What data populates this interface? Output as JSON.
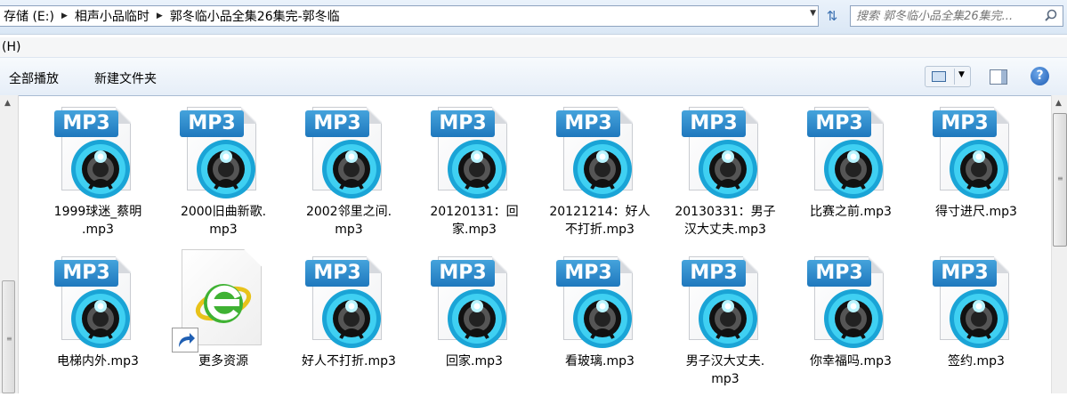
{
  "address": {
    "crumbs": [
      "存储 (E:)",
      "相声小品临时",
      "郭冬临小品全集26集完-郭冬临"
    ],
    "search_placeholder": "搜索 郭冬临小品全集26集完..."
  },
  "menu": {
    "items": [
      "(H)"
    ]
  },
  "toolbar": {
    "play_all": "全部播放",
    "new_folder": "新建文件夹"
  },
  "files": [
    {
      "name": "1999球迷_蔡明.mp3",
      "line1": "1999球迷_蔡明",
      "line2": ".mp3",
      "type": "mp3"
    },
    {
      "name": "2000旧曲新歌.mp3",
      "line1": "2000旧曲新歌.",
      "line2": "mp3",
      "type": "mp3"
    },
    {
      "name": "2002邻里之间.mp3",
      "line1": "2002邻里之间.",
      "line2": "mp3",
      "type": "mp3"
    },
    {
      "name": "20120131：回家.mp3",
      "line1": "20120131：回",
      "line2": "家.mp3",
      "type": "mp3"
    },
    {
      "name": "20121214：好人不打折.mp3",
      "line1": "20121214：好人",
      "line2": "不打折.mp3",
      "type": "mp3"
    },
    {
      "name": "20130331：男子汉大丈夫.mp3",
      "line1": "20130331：男子",
      "line2": "汉大丈夫.mp3",
      "type": "mp3"
    },
    {
      "name": "比赛之前.mp3",
      "line1": "比赛之前.mp3",
      "line2": "",
      "type": "mp3"
    },
    {
      "name": "得寸进尺.mp3",
      "line1": "得寸进尺.mp3",
      "line2": "",
      "type": "mp3"
    },
    {
      "name": "电梯内外.mp3",
      "line1": "电梯内外.mp3",
      "line2": "",
      "type": "mp3"
    },
    {
      "name": "更多资源",
      "line1": "更多资源",
      "line2": "",
      "type": "shortcut"
    },
    {
      "name": "好人不打折.mp3",
      "line1": "好人不打折.mp3",
      "line2": "",
      "type": "mp3"
    },
    {
      "name": "回家.mp3",
      "line1": "回家.mp3",
      "line2": "",
      "type": "mp3"
    },
    {
      "name": "看玻璃.mp3",
      "line1": "看玻璃.mp3",
      "line2": "",
      "type": "mp3"
    },
    {
      "name": "男子汉大丈夫.mp3",
      "line1": "男子汉大丈夫.",
      "line2": "mp3",
      "type": "mp3"
    },
    {
      "name": "你幸福吗.mp3",
      "line1": "你幸福吗.mp3",
      "line2": "",
      "type": "mp3"
    },
    {
      "name": "签约.mp3",
      "line1": "签约.mp3",
      "line2": "",
      "type": "mp3"
    }
  ],
  "icon_badge": "MP3",
  "colors": {
    "accent": "#1f78bd",
    "disc": "#22b5e0"
  }
}
